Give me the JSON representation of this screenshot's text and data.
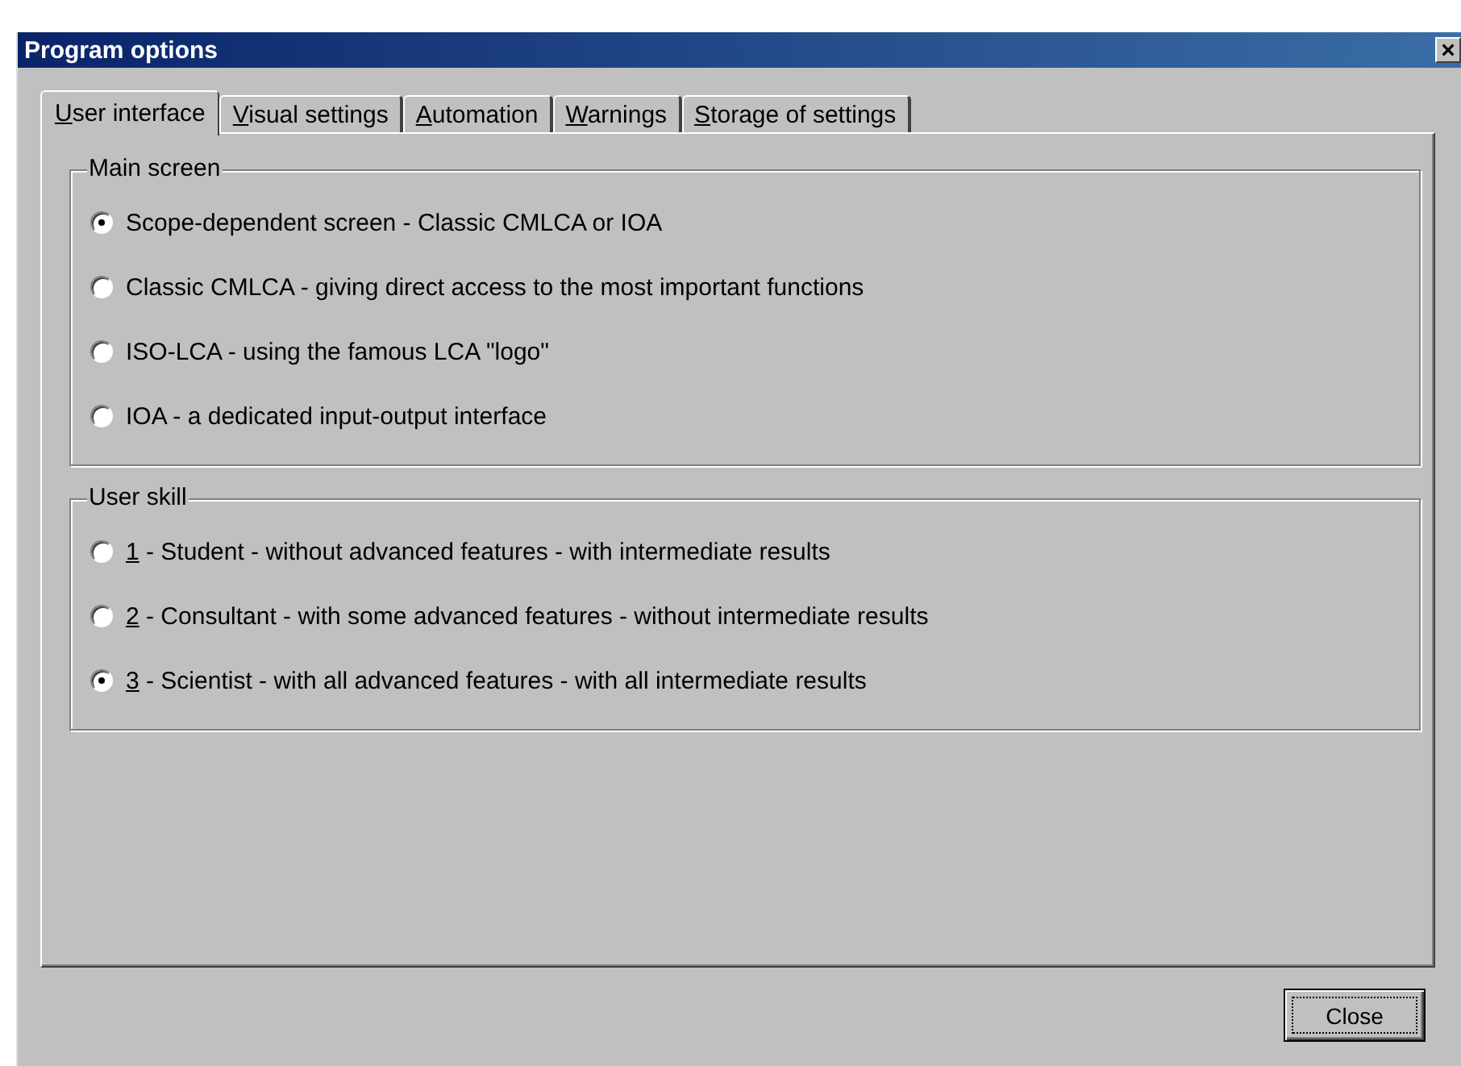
{
  "window": {
    "title": "Program options",
    "close_glyph": "×"
  },
  "tabs": [
    {
      "label": "User interface",
      "mnemonic": true,
      "selected": true
    },
    {
      "label": "Visual settings",
      "mnemonic": true,
      "selected": false
    },
    {
      "label": "Automation",
      "mnemonic": true,
      "selected": false
    },
    {
      "label": "Warnings",
      "mnemonic": true,
      "selected": false
    },
    {
      "label": "Storage of settings",
      "mnemonic": true,
      "selected": false
    }
  ],
  "groups": [
    {
      "title": "Main screen",
      "options": [
        {
          "label": "Scope-dependent screen - Classic CMLCA or IOA",
          "mnemonic": false,
          "selected": true
        },
        {
          "label": "Classic CMLCA - giving direct access to the most important functions",
          "mnemonic": false,
          "selected": false
        },
        {
          "label": "ISO-LCA - using the famous LCA \"logo\"",
          "mnemonic": false,
          "selected": false
        },
        {
          "label": "IOA - a dedicated input-output interface",
          "mnemonic": false,
          "selected": false
        }
      ]
    },
    {
      "title": "User skill",
      "options": [
        {
          "label": "1 - Student - without advanced features - with intermediate results",
          "mnemonic": true,
          "selected": false
        },
        {
          "label": "2 - Consultant - with some advanced features - without intermediate results",
          "mnemonic": true,
          "selected": false
        },
        {
          "label": "3 - Scientist - with all advanced features - with all intermediate results",
          "mnemonic": true,
          "selected": true
        }
      ]
    }
  ],
  "buttons": [
    {
      "label": "Close",
      "focused": true
    }
  ]
}
